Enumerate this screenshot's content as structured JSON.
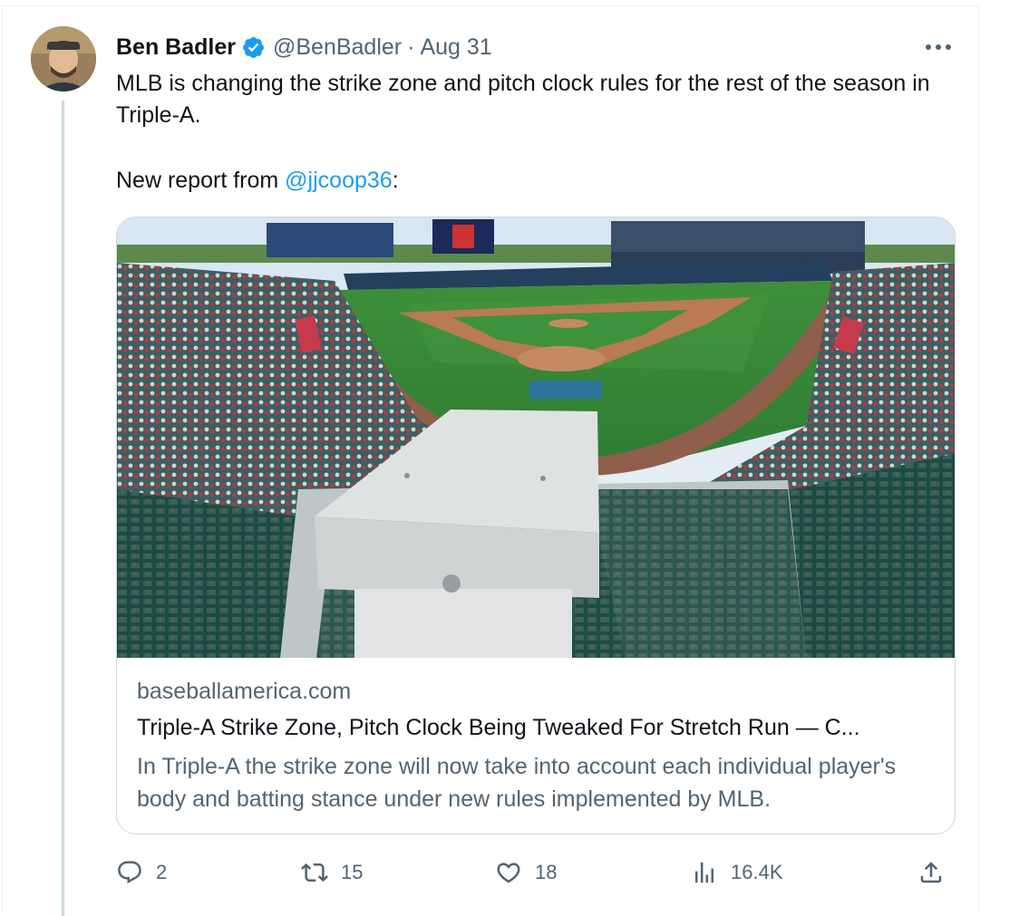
{
  "tweet": {
    "author_name": "Ben Badler",
    "handle": "@BenBadler",
    "separator": "·",
    "date": "Aug 31",
    "text_line1": "MLB is changing the strike zone and pitch clock rules for the rest of the season in Triple-A.",
    "text_line2_prefix": "New report from ",
    "mention": "@jjcoop36",
    "text_line2_suffix": ":"
  },
  "card": {
    "domain": "baseballamerica.com",
    "title": "Triple-A Strike Zone, Pitch Clock Being Tweaked For Stretch Run — C...",
    "description": "In Triple-A the strike zone will now take into account each individual player's body and batting stance under new rules implemented by MLB."
  },
  "actions": {
    "replies": "2",
    "reposts": "15",
    "likes": "18",
    "views": "16.4K"
  },
  "colors": {
    "link": "#1d9bf0",
    "secondary_text": "#536471",
    "verified_badge": "#1d9bf0",
    "border": "#cfd9de"
  },
  "icons": [
    "verified-badge-icon",
    "more-options-icon",
    "reply-icon",
    "repost-icon",
    "like-icon",
    "views-icon",
    "share-icon"
  ]
}
